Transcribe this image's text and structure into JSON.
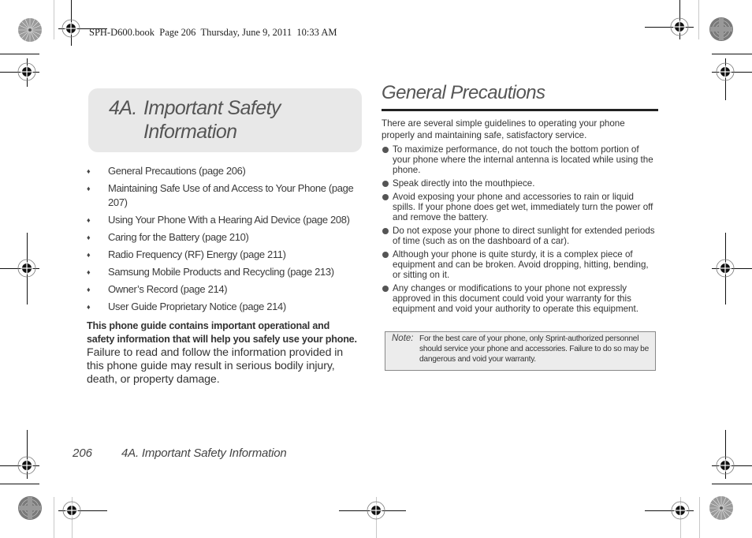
{
  "slug_line": "SPH-D600.book  Page 206  Thursday, June 9, 2011  10:33 AM",
  "chapter": {
    "number": "4A.",
    "title_line1": "Important Safety",
    "title_line2": "Information"
  },
  "toc": [
    {
      "bullet": "♦",
      "text": "General Precautions (page 206)"
    },
    {
      "bullet": "♦",
      "text": "Maintaining Safe Use of and Access to Your Phone (page 207)"
    },
    {
      "bullet": "♦",
      "text": "Using Your Phone With a Hearing Aid Device (page 208)"
    },
    {
      "bullet": "♦",
      "text": "Caring for the Battery (page 210)"
    },
    {
      "bullet": "♦",
      "text": "Radio Frequency (RF) Energy (page 211)"
    },
    {
      "bullet": "♦",
      "text": "Samsung Mobile Products and Recycling (page 213)"
    },
    {
      "bullet": "♦",
      "text": "Owner’s Record (page 214)"
    },
    {
      "bullet": "♦",
      "text": "User Guide Proprietary Notice (page 214)"
    }
  ],
  "intro": {
    "bold": "This phone guide contains important operational and safety information that will help you safely use your phone.",
    "normal": " Failure to read and follow the information provided in this phone guide may result in serious bodily injury, death, or property damage."
  },
  "section": {
    "title": "General Precautions",
    "intro": "There are several simple guidelines to operating your phone properly and maintaining safe, satisfactory service.",
    "items": [
      "To maximize performance, do not touch the bottom portion of your phone where the internal antenna is located while using the phone.",
      "Speak directly into the mouthpiece.",
      "Avoid exposing your phone and accessories to rain or liquid spills. If your phone does get wet, immediately turn the power off and remove the battery.",
      "Do not expose your phone to direct sunlight for extended periods of time (such as on the dashboard of a car).",
      "Although your phone is quite sturdy, it is a complex piece of equipment and can be broken. Avoid dropping, hitting, bending, or sitting on it.",
      "Any changes or modifications to your phone not expressly approved in this document could void your warranty for this equipment and void your authority to operate this equipment."
    ],
    "note": {
      "label": "Note:",
      "text": "For the best care of your phone, only Sprint-authorized personnel should service your phone and accessories. Failure to do so may be dangerous and void your warranty."
    }
  },
  "footer": {
    "page_number": "206",
    "chapter_title": "4A. Important Safety Information"
  }
}
